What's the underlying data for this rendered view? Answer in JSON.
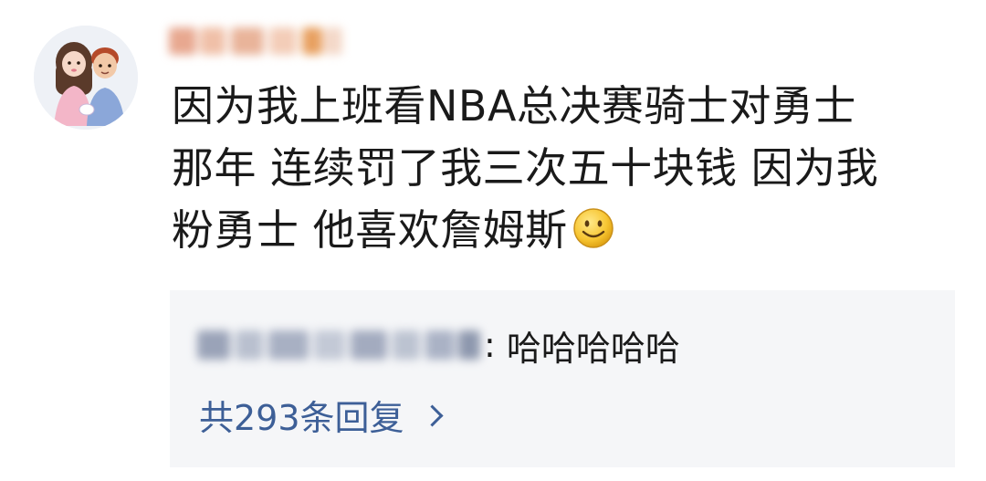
{
  "comment": {
    "lines": [
      "因为我上班看NBA总决赛骑士对勇士",
      "那年 连续罚了我三次五十块钱 因为我",
      "粉勇士 他喜欢詹姆斯"
    ],
    "emoji": "smile-emoji"
  },
  "reply": {
    "colon": ":",
    "text": "哈哈哈哈哈"
  },
  "reply_count_label": "共293条回复",
  "icons": {
    "avatar": "avatar-couple",
    "more": "chevron-right-icon"
  }
}
